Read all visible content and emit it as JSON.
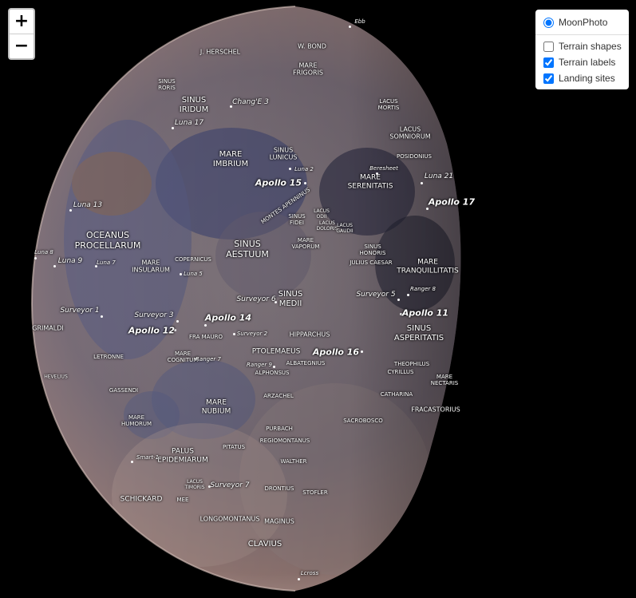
{
  "zoom": {
    "in_label": "+",
    "out_label": "−"
  },
  "layers": {
    "base": [
      {
        "label": "MoonPhoto",
        "checked": true
      }
    ],
    "overlays": [
      {
        "label": "Terrain shapes",
        "checked": false
      },
      {
        "label": "Terrain labels",
        "checked": true
      },
      {
        "label": "Landing sites",
        "checked": true
      }
    ]
  },
  "terrain_labels": [
    "J. HERSCHEL",
    "W. BOND",
    "MARE\nFRIGORIS",
    "SINUS\nRORIS",
    "SINUS\nIRIDUM",
    "LACUS\nMORTIS",
    "LACUS\nSOMNIORUM",
    "POSIDONIUS",
    "MARE\nIMBRIUM",
    "SINUS\nLUNICUS",
    "MARE\nSERENITATIS",
    "OCEANUS\nPROCELLARUM",
    "MONTES APENNINUS",
    "SINUS\nFIDEI",
    "LACUS\nODII",
    "LACUS\nDOLORIS",
    "LACUS\nGAUDII",
    "MARE\nVAPORUM",
    "SINUS\nAESTUUM",
    "SINUS\nHONORIS",
    "JULIUS CAESAR",
    "MARE\nTRANQUILLITATIS",
    "COPERNICUS",
    "MARE\nINSULARUM",
    "SINUS\nMEDII",
    "SINUS\nASPERITATIS",
    "GRIMALDI",
    "FRA MAURO",
    "HIPPARCHUS",
    "PTOLEMAEUS",
    "LETRONNE",
    "MARE\nCOGNITUM",
    "ALBATEGNIUS",
    "ALPHONSUS",
    "THEOPHILUS",
    "CYRILLUS",
    "MARE\nNECTARIS",
    "HEVELIUS",
    "GASSENDI",
    "ARZACHEL",
    "CATHARINA",
    "MARE\nNUBIUM",
    "FRACASTORIUS",
    "MARE\nHUMORUM",
    "SACROBOSCO",
    "PURBACH",
    "REGIOMONTANUS",
    "PITATUS",
    "PALUS\nEPIDEMIARUM",
    "WALTHER",
    "LACUS\nTIMORIS",
    "SCHICKARD",
    "MEE",
    "DRONTIUS",
    "STOFLER",
    "LONGOMONTANUS",
    "MAGINUS",
    "CLAVIUS"
  ],
  "landing_sites": [
    "Ebb",
    "Chang'E 3",
    "Luna 17",
    "Luna 2",
    "Beresheet",
    "Luna 21",
    "Apollo 15",
    "Apollo 17",
    "Luna 13",
    "Luna 8",
    "Luna 9",
    "Luna 7",
    "Luna 5",
    "Ranger 8",
    "Surveyor 6",
    "Surveyor 5",
    "Apollo 11",
    "Surveyor 1",
    "Surveyor 3",
    "Apollo 14",
    "Apollo 12",
    "Surveyor 2",
    "Apollo 16",
    "Ranger 7",
    "Ranger 9",
    "Smart-1",
    "Surveyor 7",
    "Lcross"
  ],
  "colors": {
    "background": "#000000",
    "label": "#ffffff",
    "control_bg": "#ffffff"
  }
}
